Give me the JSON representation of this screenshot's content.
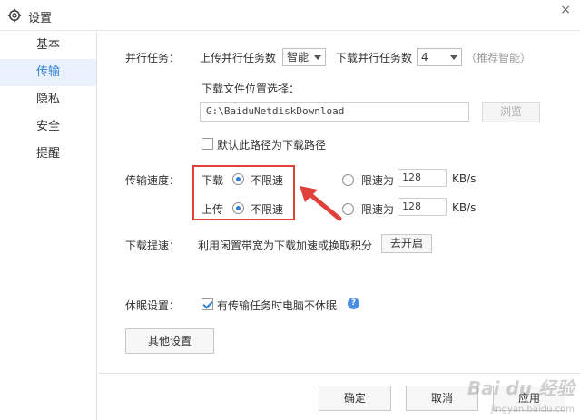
{
  "window": {
    "title": "设置",
    "icon": "gear-icon",
    "close_glyph": "×"
  },
  "sidebar": {
    "items": [
      {
        "label": "基本",
        "active": false
      },
      {
        "label": "传输",
        "active": true
      },
      {
        "label": "隐私",
        "active": false
      },
      {
        "label": "安全",
        "active": false
      },
      {
        "label": "提醒",
        "active": false
      }
    ]
  },
  "parallel": {
    "label": "并行任务：",
    "upload_label": "上传并行任务数",
    "upload_value": "智能",
    "download_label": "下载并行任务数",
    "download_value": "4",
    "hint": "（推荐智能）"
  },
  "download_location": {
    "label": "下载文件位置选择：",
    "path": "G:\\BaiduNetdiskDownload",
    "browse_label": "浏览",
    "default_checkbox_label": "默认此路径为下载路径",
    "default_checked": false
  },
  "speed": {
    "label": "传输速度：",
    "download_label": "下载",
    "upload_label": "上传",
    "unlimited_label": "不限速",
    "limit_label": "限速为",
    "download_limit_value": "128",
    "upload_limit_value": "128",
    "unit": "KB/s",
    "download_unlimited": true,
    "upload_unlimited": true
  },
  "boost": {
    "label": "下载提速：",
    "description": "利用闲置带宽为下载加速或换取积分",
    "button_label": "去开启"
  },
  "sleep": {
    "label": "休眠设置：",
    "checkbox_label": "有传输任务时电脑不休眠",
    "checked": true,
    "help_glyph": "?"
  },
  "other_settings_label": "其他设置",
  "footer": {
    "ok_label": "确定",
    "cancel_label": "取消",
    "apply_label": "应用"
  },
  "colors": {
    "accent": "#2f7fd6",
    "active_bg": "#e8f1fc",
    "annotation_red": "#e0403a"
  },
  "watermark": {
    "text": "Bai du 经验",
    "sub": "jingyan.baidu.com"
  }
}
